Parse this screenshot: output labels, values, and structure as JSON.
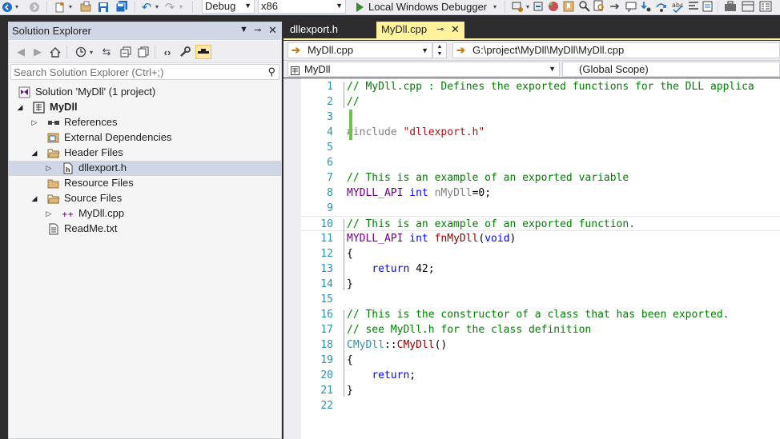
{
  "toolbar": {
    "config": "Debug",
    "platform": "x86",
    "debugger": "Local Windows Debugger"
  },
  "solution_explorer": {
    "title": "Solution Explorer",
    "search_placeholder": "Search Solution Explorer (Ctrl+;)",
    "tree": [
      {
        "label": "Solution 'MyDll' (1 project)",
        "icon": "solution-icon",
        "bold": false
      },
      {
        "label": "MyDll",
        "icon": "project-icon",
        "bold": true
      },
      {
        "label": "References",
        "icon": "references-icon",
        "bold": false
      },
      {
        "label": "External Dependencies",
        "icon": "external-dependencies-icon",
        "bold": false
      },
      {
        "label": "Header Files",
        "icon": "folder-icon",
        "bold": false
      },
      {
        "label": "dllexport.h",
        "icon": "header-file-icon",
        "bold": false
      },
      {
        "label": "Resource Files",
        "icon": "folder-icon",
        "bold": false
      },
      {
        "label": "Source Files",
        "icon": "folder-icon",
        "bold": false
      },
      {
        "label": "MyDll.cpp",
        "icon": "cpp-file-icon",
        "bold": false
      },
      {
        "label": "ReadMe.txt",
        "icon": "text-file-icon",
        "bold": false
      }
    ]
  },
  "editor": {
    "tabs": [
      {
        "label": "dllexport.h",
        "active": false
      },
      {
        "label": "MyDll.cpp",
        "active": true
      }
    ],
    "nav_file": "MyDll.cpp",
    "nav_path": "G:\\project\\MyDll\\MyDll\\MyDll.cpp",
    "scope_project": "MyDll",
    "scope": "(Global Scope)",
    "lines": [
      {
        "n": "1",
        "parts": [
          {
            "t": "// MyDll.cpp : Defines the exported functions for the DLL applica",
            "c": "com"
          }
        ]
      },
      {
        "n": "2",
        "parts": [
          {
            "t": "//",
            "c": "com"
          }
        ]
      },
      {
        "n": "3",
        "parts": []
      },
      {
        "n": "4",
        "parts": [
          {
            "t": "#include ",
            "c": "pre"
          },
          {
            "t": "\"dllexport.h\"",
            "c": "str"
          }
        ]
      },
      {
        "n": "5",
        "parts": []
      },
      {
        "n": "6",
        "parts": []
      },
      {
        "n": "7",
        "parts": [
          {
            "t": "// This is an example of an exported variable",
            "c": "com"
          }
        ]
      },
      {
        "n": "8",
        "parts": [
          {
            "t": "MYDLL_API ",
            "c": "mac"
          },
          {
            "t": "int ",
            "c": "kw"
          },
          {
            "t": "nMyDll",
            "c": "var"
          },
          {
            "t": "=0;",
            "c": "plain"
          }
        ]
      },
      {
        "n": "9",
        "parts": []
      },
      {
        "n": "10",
        "parts": [
          {
            "t": "// This is an example of an exported function.",
            "c": "com"
          }
        ]
      },
      {
        "n": "11",
        "parts": [
          {
            "t": "MYDLL_API ",
            "c": "mac"
          },
          {
            "t": "int ",
            "c": "kw"
          },
          {
            "t": "fnMyDll",
            "c": "fn"
          },
          {
            "t": "(",
            "c": "plain"
          },
          {
            "t": "void",
            "c": "kw"
          },
          {
            "t": ")",
            "c": "plain"
          }
        ]
      },
      {
        "n": "12",
        "parts": [
          {
            "t": "{",
            "c": "plain"
          }
        ]
      },
      {
        "n": "13",
        "parts": [
          {
            "t": "    ",
            "c": "plain"
          },
          {
            "t": "return ",
            "c": "kw"
          },
          {
            "t": "42;",
            "c": "plain"
          }
        ]
      },
      {
        "n": "14",
        "parts": [
          {
            "t": "}",
            "c": "plain"
          }
        ]
      },
      {
        "n": "15",
        "parts": []
      },
      {
        "n": "16",
        "parts": [
          {
            "t": "// This is the constructor of a class that has been exported.",
            "c": "com"
          }
        ]
      },
      {
        "n": "17",
        "parts": [
          {
            "t": "// see MyDll.h for the class definition",
            "c": "com"
          }
        ]
      },
      {
        "n": "18",
        "parts": [
          {
            "t": "CMyDll",
            "c": "cls"
          },
          {
            "t": "::",
            "c": "plain"
          },
          {
            "t": "CMyDll",
            "c": "fn"
          },
          {
            "t": "()",
            "c": "plain"
          }
        ]
      },
      {
        "n": "19",
        "parts": [
          {
            "t": "{",
            "c": "plain"
          }
        ]
      },
      {
        "n": "20",
        "parts": [
          {
            "t": "    ",
            "c": "plain"
          },
          {
            "t": "return",
            "c": "kw"
          },
          {
            "t": ";",
            "c": "plain"
          }
        ]
      },
      {
        "n": "21",
        "parts": [
          {
            "t": "}",
            "c": "plain"
          }
        ]
      },
      {
        "n": "22",
        "parts": []
      }
    ]
  },
  "colors": {
    "tab_active": "#fff29d",
    "selection": "#cfd6e5",
    "line_number": "#2b91af",
    "comment": "#008000",
    "keyword": "#0000ff",
    "macro": "#6f008a",
    "change_marker": "#6cc24a"
  }
}
